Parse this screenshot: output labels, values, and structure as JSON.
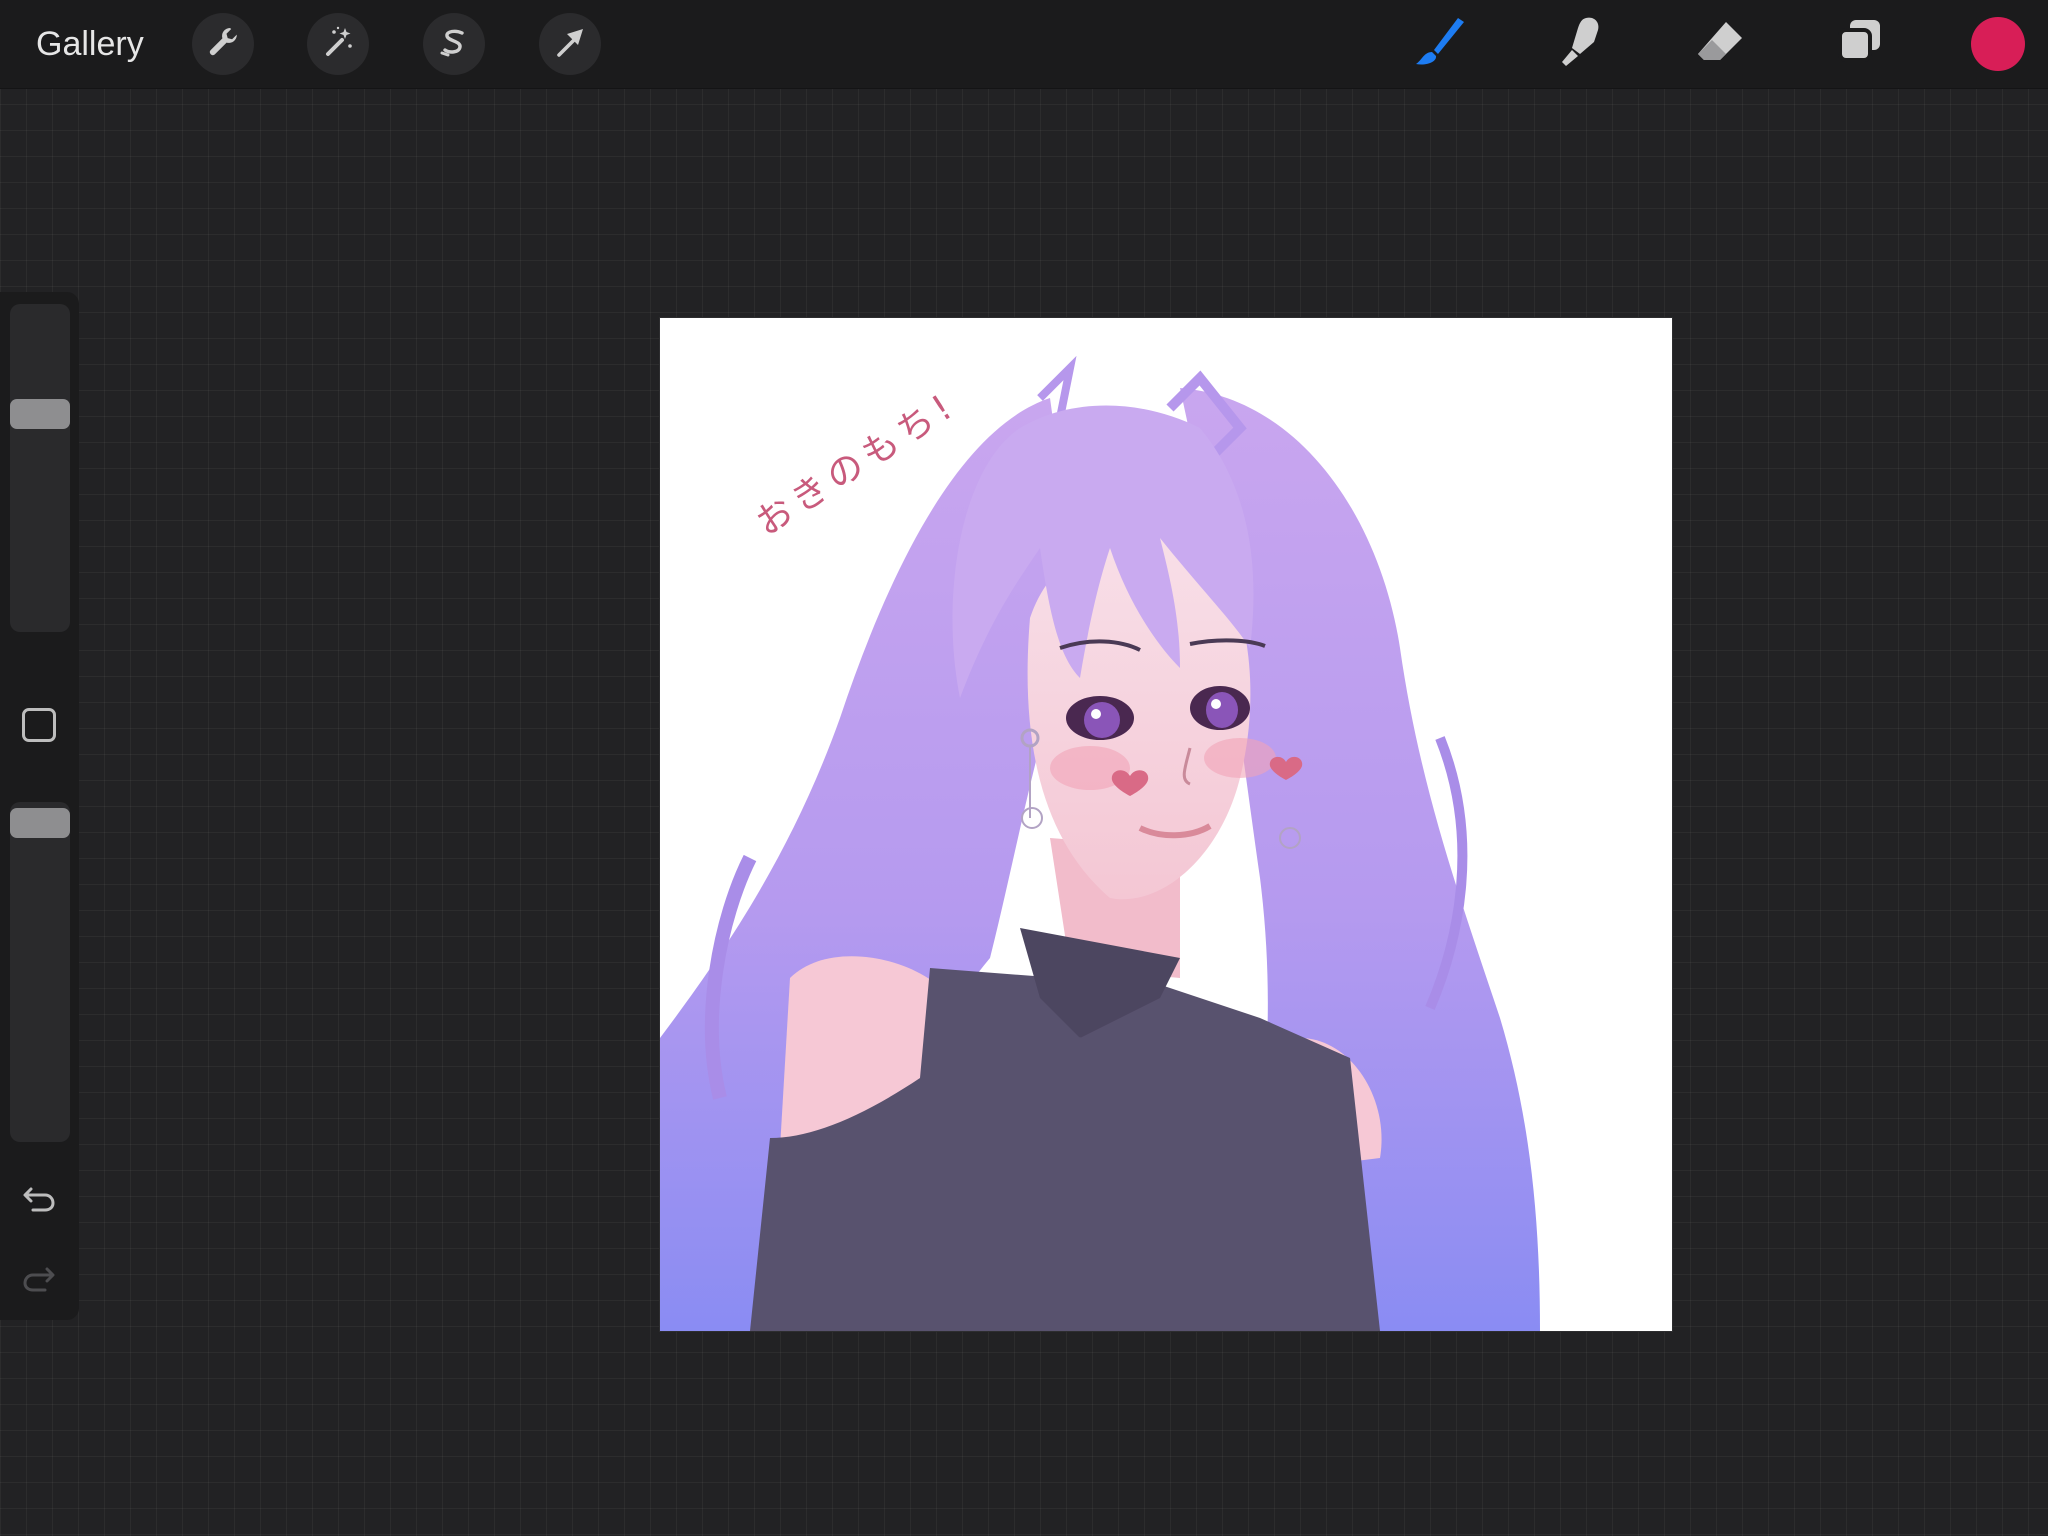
{
  "topbar": {
    "gallery_label": "Gallery",
    "tools_left": [
      {
        "name": "actions",
        "icon": "wrench-icon"
      },
      {
        "name": "adjustments",
        "icon": "magic-wand-icon"
      },
      {
        "name": "selection",
        "icon": "selection-s-icon"
      },
      {
        "name": "transform",
        "icon": "arrow-cursor-icon"
      }
    ],
    "tools_right": [
      {
        "name": "brush",
        "icon": "brush-icon",
        "active": true
      },
      {
        "name": "smudge",
        "icon": "smudge-finger-icon",
        "active": false
      },
      {
        "name": "eraser",
        "icon": "eraser-icon",
        "active": false
      },
      {
        "name": "layers",
        "icon": "layers-icon",
        "active": false
      }
    ],
    "current_color": "#d81e57"
  },
  "sidebar": {
    "brush_size_level": 0.68,
    "opacity_level": 0.98,
    "modify_button": "square-icon",
    "undo_icon": "undo-icon",
    "redo_icon": "redo-icon"
  },
  "canvas": {
    "signature": "おきのもち!"
  },
  "colors": {
    "accent_active": "#1d7cf2",
    "toolbar_bg": "#1b1b1c",
    "workspace_bg": "#222224"
  }
}
